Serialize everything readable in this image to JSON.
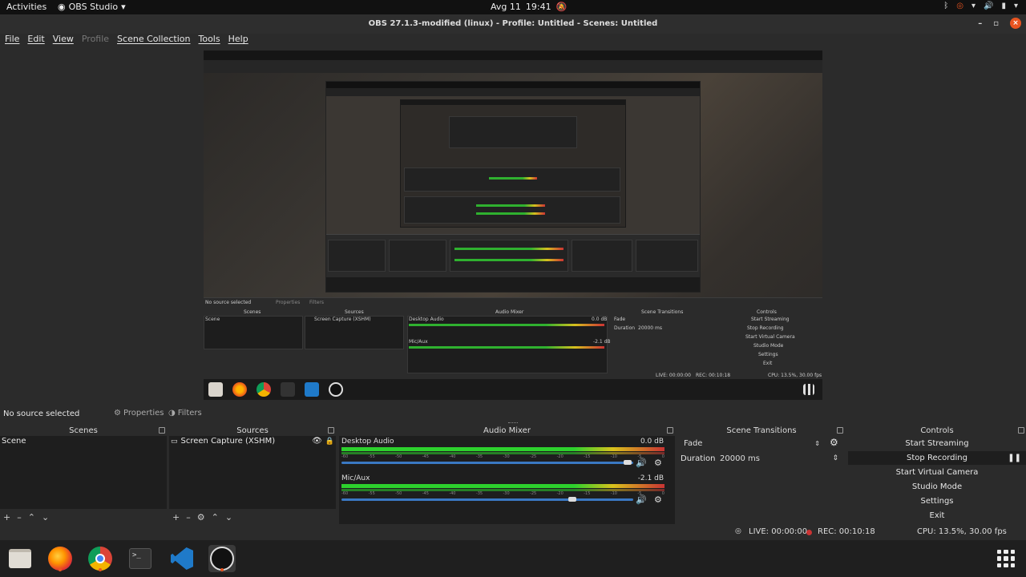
{
  "topbar": {
    "activities": "Activities",
    "app_name": "OBS Studio",
    "date": "Avg 11",
    "time": "19:41"
  },
  "window": {
    "title": "OBS 27.1.3-modified (linux) - Profile: Untitled - Scenes: Untitled"
  },
  "menu": {
    "file": "File",
    "edit": "Edit",
    "view": "View",
    "profile": "Profile",
    "scene_collection": "Scene Collection",
    "tools": "Tools",
    "help": "Help"
  },
  "source_toolbar": {
    "no_source": "No source selected",
    "properties": "Properties",
    "filters": "Filters"
  },
  "scenes": {
    "header": "Scenes",
    "items": [
      "Scene"
    ]
  },
  "sources": {
    "header": "Sources",
    "items": [
      "Screen Capture (XSHM)"
    ]
  },
  "mixer": {
    "header": "Audio Mixer",
    "channels": [
      {
        "name": "Desktop Audio",
        "db": "0.0 dB",
        "volume": 0.98
      },
      {
        "name": "Mic/Aux",
        "db": "-2.1 dB",
        "volume": 0.79
      }
    ],
    "ticks": [
      "-60",
      "-55",
      "-50",
      "-45",
      "-40",
      "-35",
      "-30",
      "-25",
      "-20",
      "-15",
      "-10",
      "-5",
      "0"
    ]
  },
  "transitions": {
    "header": "Scene Transitions",
    "type": "Fade",
    "duration_label": "Duration",
    "duration_value": "20000 ms"
  },
  "controls": {
    "header": "Controls",
    "start_streaming": "Start Streaming",
    "stop_recording": "Stop Recording",
    "start_virtual_camera": "Start Virtual Camera",
    "studio_mode": "Studio Mode",
    "settings": "Settings",
    "exit": "Exit"
  },
  "status": {
    "live": "LIVE: 00:00:00",
    "rec": "REC: 00:10:18",
    "cpu": "CPU: 13.5%, 30.00 fps"
  },
  "colors": {
    "accent": "#e95420",
    "meter_green": "#2dd12d",
    "meter_yellow": "#d9c21c",
    "meter_red": "#c93333",
    "slider_blue": "#3a78c3"
  },
  "taskbar": {
    "apps": [
      "files-icon",
      "firefox-icon",
      "chrome-icon",
      "terminal-icon",
      "vscode-icon",
      "obs-icon"
    ]
  }
}
